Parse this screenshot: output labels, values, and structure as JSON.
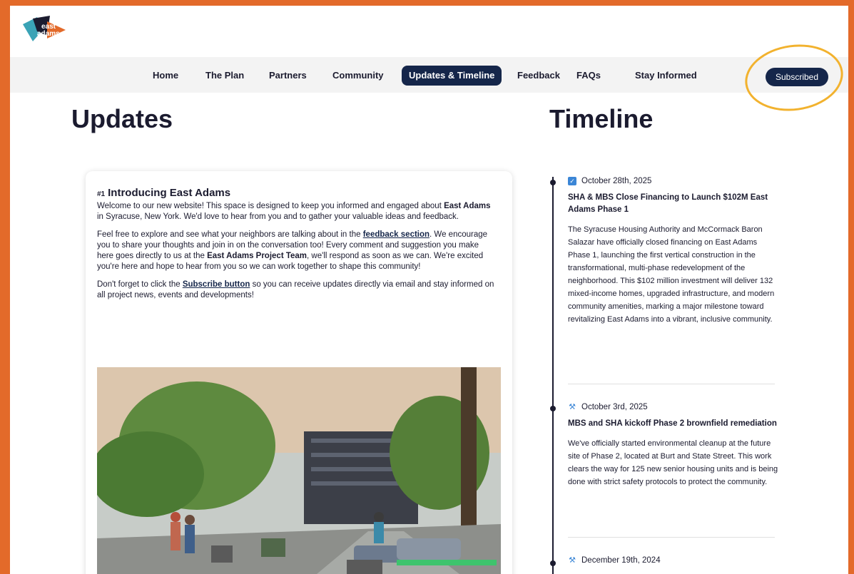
{
  "nav": {
    "items": [
      "Home",
      "The Plan",
      "Partners",
      "Community",
      "Updates & Timeline",
      "Feedback",
      "FAQs",
      "Stay Informed"
    ],
    "subscribe_label": "Subscribed"
  },
  "logo": {
    "text": "east adams"
  },
  "updates": {
    "heading": "Updates",
    "post": {
      "number": "#1",
      "title": "Introducing East Adams",
      "p1a": "Welcome to our new website! This space is designed to keep you informed and engaged about ",
      "p1b": "East Adams",
      "p1c": " in Syracuse, New York. We'd love to hear from you and to gather your valuable ideas and feedback.",
      "p2a": "Feel free to explore and see what your neighbors are talking about in the ",
      "p2link": "feedback section",
      "p2b": ". We encourage you to share your thoughts and join in on the conversation too! Every comment and suggestion you make here goes directly to us at the ",
      "p2bold": "East Adams Project Team",
      "p2c": ", we'll respond as soon as we can. We're excited you're here and hope to hear from you so we can work together to shape this community!",
      "p3a": "Don't forget to click the ",
      "p3link": "Subscribe button",
      "p3b": " so you can receive updates directly via email and stay informed on all project news, events and developments!"
    }
  },
  "timeline": {
    "heading": "Timeline",
    "entries": [
      {
        "icon": "check-box-icon",
        "date": "October 28th, 2025",
        "title": "SHA & MBS Close Financing to Launch $102M East Adams Phase 1",
        "body": "The Syracuse Housing Authority and McCormack Baron Salazar have officially closed financing on East Adams Phase 1, launching the first vertical construction in the transformational, multi-phase redevelopment of the neighborhood. This $102 million investment will deliver 132 mixed-income homes, upgraded infrastructure, and modern community amenities, marking a major milestone toward revitalizing East Adams into a vibrant, inclusive community."
      },
      {
        "icon": "tools-icon",
        "date": "October 3rd, 2025",
        "title": "MBS and SHA kickoff Phase 2 brownfield remediation",
        "body": "We've officially started environmental cleanup at the future site of Phase 2, located at Burt and State Street. This work clears the way for 125 new senior housing units and is being done with strict safety protocols to protect the community."
      },
      {
        "icon": "tools-icon",
        "date": "December 19th, 2024",
        "title": "",
        "body": ""
      }
    ]
  },
  "colors": {
    "accent": "#15264a",
    "frame": "#e36a2a",
    "highlight": "#f2b22e",
    "icon": "#3b86d6"
  }
}
